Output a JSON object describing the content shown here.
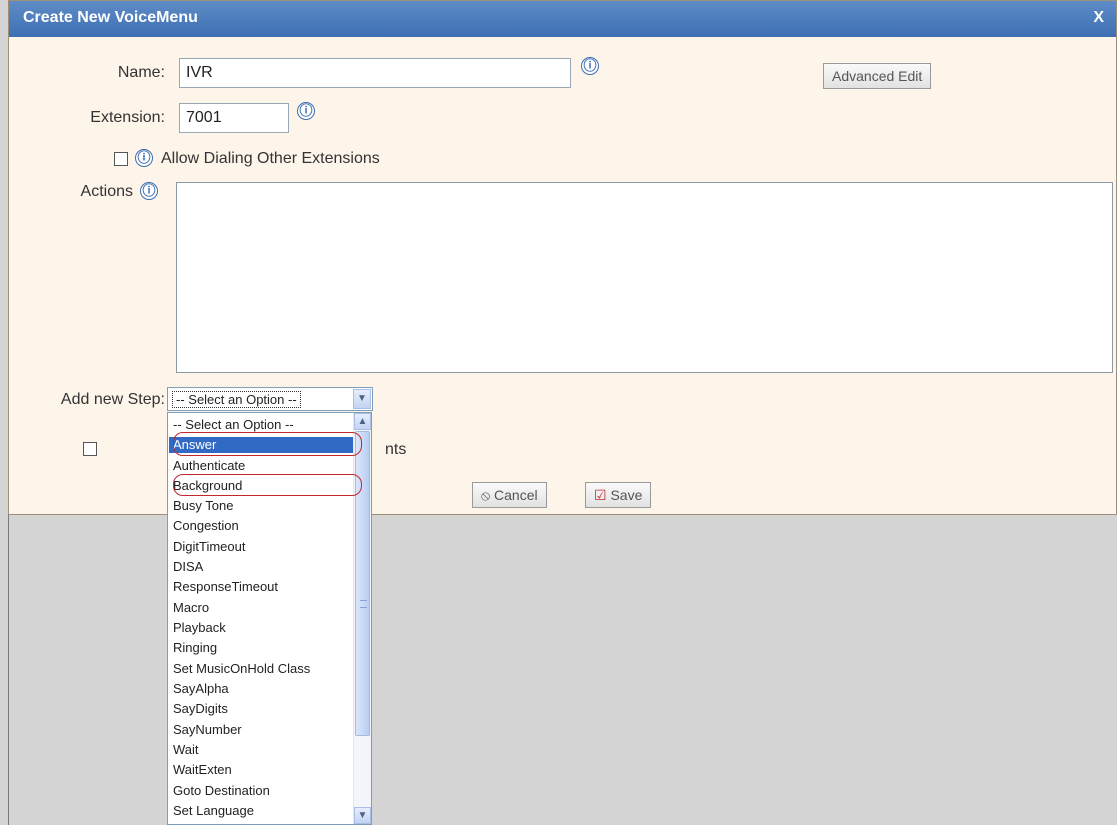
{
  "dialog": {
    "title": "Create New VoiceMenu",
    "close_label": "X"
  },
  "form": {
    "name_label": "Name:",
    "name_value": "IVR",
    "advanced_edit_label": "Advanced Edit",
    "extension_label": "Extension:",
    "extension_value": "7001",
    "allow_dialing_label": "Allow Dialing Other Extensions",
    "actions_label": "Actions",
    "add_step_label": "Add new Step:",
    "second_checkbox_label_fragment": "nts"
  },
  "icons": {
    "info": "ⓘ",
    "info_name": "info-icon",
    "cancel_icon": "⦸",
    "save_icon": "☑"
  },
  "buttons": {
    "cancel_label": "Cancel",
    "save_label": "Save"
  },
  "select": {
    "selected": "-- Select an Option --"
  },
  "dropdown": {
    "options": [
      "-- Select an Option --",
      "Answer",
      "Authenticate",
      "Background",
      "Busy Tone",
      "Congestion",
      "DigitTimeout",
      "DISA",
      "ResponseTimeout",
      "Macro",
      "Playback",
      "Ringing",
      "Set MusicOnHold Class",
      "SayAlpha",
      "SayDigits",
      "SayNumber",
      "Wait",
      "WaitExten",
      "Goto Destination",
      "Set Language"
    ],
    "highlighted_index": 1,
    "circled_indices": [
      1,
      3
    ]
  },
  "colors": {
    "titlebar": "#4a7cbc",
    "highlight": "#316ac5",
    "annotation_ring": "#c0282d",
    "dialog_bg": "#fdf4ea"
  }
}
